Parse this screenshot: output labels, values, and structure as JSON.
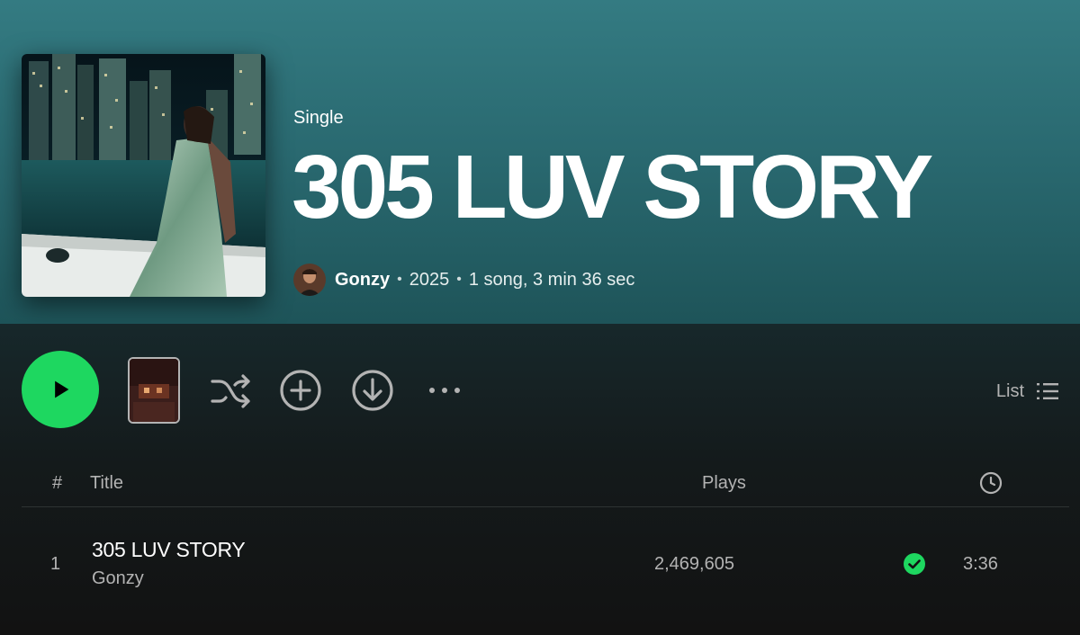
{
  "album": {
    "type_label": "Single",
    "title": "305 LUV STORY",
    "artist": "Gonzy",
    "separator": "•",
    "year": "2025",
    "summary": "1 song, 3 min 36 sec"
  },
  "actions": {
    "view_mode_label": "List"
  },
  "table": {
    "headers": {
      "number": "#",
      "title": "Title",
      "plays": "Plays"
    },
    "tracks": [
      {
        "number": "1",
        "title": "305 LUV STORY",
        "artist": "Gonzy",
        "plays": "2,469,605",
        "duration": "3:36",
        "saved": true
      }
    ]
  },
  "colors": {
    "accent": "#1ed760",
    "header_gradient_top": "#347b82",
    "header_gradient_bottom": "#1e5459",
    "background": "#121212",
    "muted_text": "#b3b3b3"
  },
  "icons": [
    "play-icon",
    "shuffle-icon",
    "add-circle-icon",
    "download-icon",
    "more-icon",
    "list-view-icon",
    "clock-icon",
    "saved-check-icon"
  ]
}
